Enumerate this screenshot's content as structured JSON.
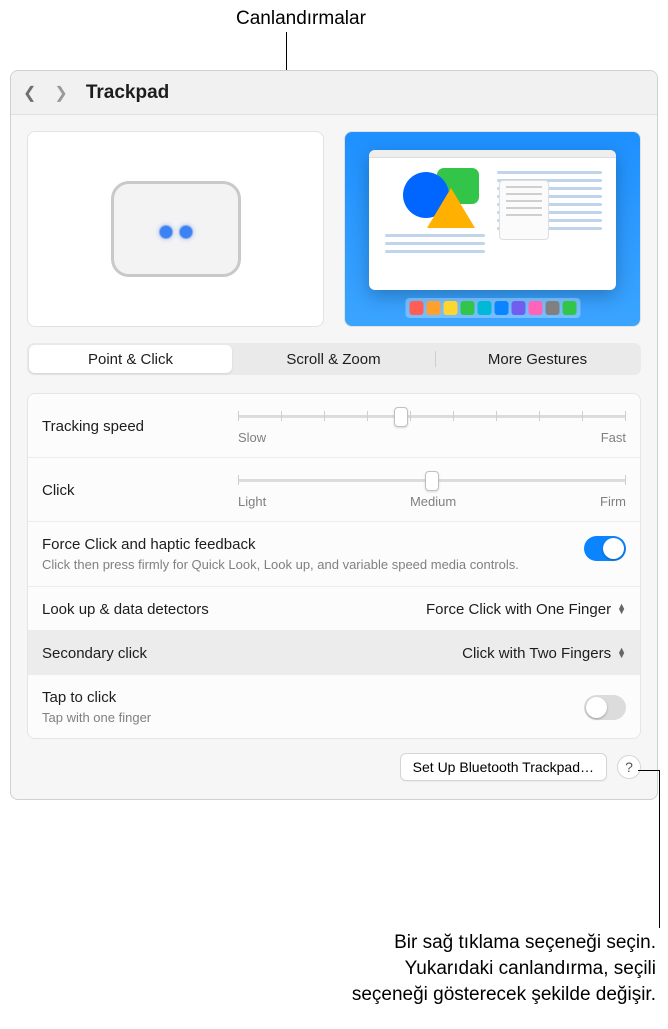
{
  "callouts": {
    "top": "Canlandırmalar",
    "bottom_1": "Bir sağ tıklama seçeneği seçin.",
    "bottom_2": "Yukarıdaki canlandırma, seçili",
    "bottom_3": "seçeneği gösterecek şekilde değişir."
  },
  "titlebar": {
    "title": "Trackpad"
  },
  "tabs": {
    "point_click": "Point & Click",
    "scroll_zoom": "Scroll & Zoom",
    "more_gestures": "More Gestures"
  },
  "settings": {
    "tracking_speed": {
      "label": "Tracking speed",
      "low": "Slow",
      "high": "Fast"
    },
    "click": {
      "label": "Click",
      "low": "Light",
      "mid": "Medium",
      "high": "Firm"
    },
    "force_click": {
      "label": "Force Click and haptic feedback",
      "desc": "Click then press firmly for Quick Look, Look up, and variable speed media controls."
    },
    "lookup": {
      "label": "Look up & data detectors",
      "value": "Force Click with One Finger"
    },
    "secondary": {
      "label": "Secondary click",
      "value": "Click with Two Fingers"
    },
    "tap": {
      "label": "Tap to click",
      "desc": "Tap with one finger"
    }
  },
  "actions": {
    "bluetooth": "Set Up Bluetooth Trackpad…",
    "help": "?"
  },
  "dock_colors": [
    "#ff5e57",
    "#ff9f2e",
    "#ffd52e",
    "#33c44a",
    "#00b9d6",
    "#0a84ff",
    "#6f5ef0",
    "#ff64b8",
    "#808080",
    "#33c44a"
  ]
}
